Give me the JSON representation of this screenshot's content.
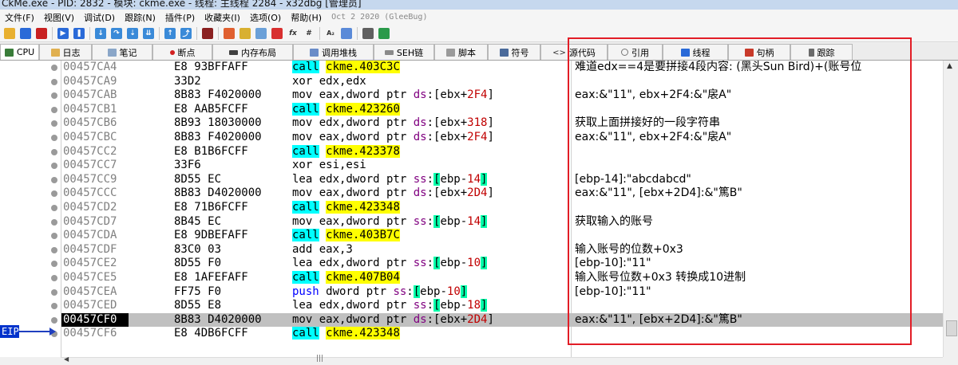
{
  "window": {
    "title": "CkMe.exe - PID: 2832 - 模块: ckme.exe - 线程: 主线程 2284 - x32dbg [管理员]"
  },
  "menu": {
    "items": [
      "文件(F)",
      "视图(V)",
      "调试(D)",
      "跟踪(N)",
      "插件(P)",
      "收藏夹(I)",
      "选项(O)",
      "帮助(H)"
    ],
    "build_date": "Oct 2 2020 (GleeBug)"
  },
  "tabs": [
    {
      "label": "CPU",
      "icon": "cpu-icon",
      "color": "#3a7d3a"
    },
    {
      "label": "日志",
      "icon": "log-icon",
      "color": "#e0b050"
    },
    {
      "label": "笔记",
      "icon": "notes-icon",
      "color": "#8aa6c8"
    },
    {
      "label": "断点",
      "icon": "breakpoint-icon",
      "color": "#d22020"
    },
    {
      "label": "内存布局",
      "icon": "memory-map-icon",
      "color": "#404040"
    },
    {
      "label": "调用堆栈",
      "icon": "call-stack-icon",
      "color": "#6a8cc8"
    },
    {
      "label": "SEH链",
      "icon": "seh-chain-icon",
      "color": "#8a8a8a"
    },
    {
      "label": "脚本",
      "icon": "script-icon",
      "color": "#9a9a9a"
    },
    {
      "label": "符号",
      "icon": "symbols-icon",
      "color": "#4a6a9a"
    },
    {
      "label": "源代码",
      "icon": "source-code-icon",
      "color": "#4a4a4a"
    },
    {
      "label": "引用",
      "icon": "references-icon",
      "color": "#7a7a7a"
    },
    {
      "label": "线程",
      "icon": "threads-icon",
      "color": "#2a6ad8"
    },
    {
      "label": "句柄",
      "icon": "handles-icon",
      "color": "#c83a2a"
    },
    {
      "label": "跟踪",
      "icon": "trace-icon",
      "color": "#6a6a6a"
    }
  ],
  "eip_label": "EIP",
  "disassembly": [
    {
      "addr": "00457CA4",
      "bytes": "E8 93BFFAFF",
      "op": "call",
      "operand": "ckme.403C3C",
      "comment": "难道edx==4是要拼接4段内容: (黑头Sun Bird)+(账号位"
    },
    {
      "addr": "00457CA9",
      "bytes": "33D2",
      "op": "xor",
      "operand": "edx,edx",
      "comment": ""
    },
    {
      "addr": "00457CAB",
      "bytes": "8B83 F4020000",
      "op": "mov",
      "operand": "eax,dword ptr ds:[ebx+2F4]",
      "comment": "eax:&\"11\", ebx+2F4:&\"扆A\""
    },
    {
      "addr": "00457CB1",
      "bytes": "E8 AAB5FCFF",
      "op": "call",
      "operand": "ckme.423260",
      "comment": ""
    },
    {
      "addr": "00457CB6",
      "bytes": "8B93 18030000",
      "op": "mov",
      "operand": "edx,dword ptr ds:[ebx+318]",
      "comment": "获取上面拼接好的一段字符串"
    },
    {
      "addr": "00457CBC",
      "bytes": "8B83 F4020000",
      "op": "mov",
      "operand": "eax,dword ptr ds:[ebx+2F4]",
      "comment": "eax:&\"11\", ebx+2F4:&\"扆A\""
    },
    {
      "addr": "00457CC2",
      "bytes": "E8 B1B6FCFF",
      "op": "call",
      "operand": "ckme.423378",
      "comment": ""
    },
    {
      "addr": "00457CC7",
      "bytes": "33F6",
      "op": "xor",
      "operand": "esi,esi",
      "comment": ""
    },
    {
      "addr": "00457CC9",
      "bytes": "8D55 EC",
      "op": "lea",
      "operand": "edx,dword ptr ss:[ebp-14]",
      "comment": "[ebp-14]:\"abcdabcd\""
    },
    {
      "addr": "00457CCC",
      "bytes": "8B83 D4020000",
      "op": "mov",
      "operand": "eax,dword ptr ds:[ebx+2D4]",
      "comment": "eax:&\"11\", [ebx+2D4]:&\"篤B\""
    },
    {
      "addr": "00457CD2",
      "bytes": "E8 71B6FCFF",
      "op": "call",
      "operand": "ckme.423348",
      "comment": ""
    },
    {
      "addr": "00457CD7",
      "bytes": "8B45 EC",
      "op": "mov",
      "operand": "eax,dword ptr ss:[ebp-14]",
      "comment": "获取输入的账号"
    },
    {
      "addr": "00457CDA",
      "bytes": "E8 9DBEFAFF",
      "op": "call",
      "operand": "ckme.403B7C",
      "comment": ""
    },
    {
      "addr": "00457CDF",
      "bytes": "83C0 03",
      "op": "add",
      "operand": "eax,3",
      "comment": "输入账号的位数+0x3"
    },
    {
      "addr": "00457CE2",
      "bytes": "8D55 F0",
      "op": "lea",
      "operand": "edx,dword ptr ss:[ebp-10]",
      "comment": "[ebp-10]:\"11\""
    },
    {
      "addr": "00457CE5",
      "bytes": "E8 1AFEFAFF",
      "op": "call",
      "operand": "ckme.407B04",
      "comment": "输入账号位数+0x3 转换成10进制"
    },
    {
      "addr": "00457CEA",
      "bytes": "FF75 F0",
      "op": "push",
      "operand": "dword ptr ss:[ebp-10]",
      "comment": "[ebp-10]:\"11\""
    },
    {
      "addr": "00457CED",
      "bytes": "8D55 E8",
      "op": "lea",
      "operand": "edx,dword ptr ss:[ebp-18]",
      "comment": ""
    },
    {
      "addr": "00457CF0",
      "bytes": "8B83 D4020000",
      "op": "mov",
      "operand": "eax,dword ptr ds:[ebx+2D4]",
      "comment": "eax:&\"11\", [ebx+2D4]:&\"篤B\"",
      "current": true
    },
    {
      "addr": "00457CF6",
      "bytes": "E8 4DB6FCFF",
      "op": "call",
      "operand": "ckme.423348",
      "comment": ""
    }
  ]
}
